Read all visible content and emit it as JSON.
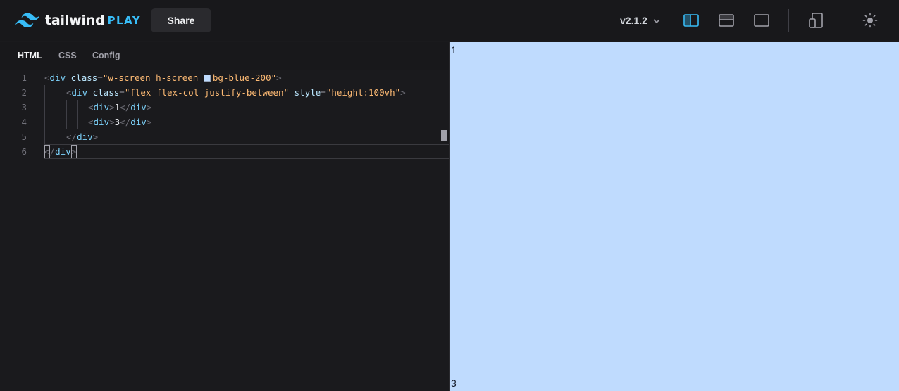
{
  "header": {
    "logo_word": "tailwind",
    "logo_play": "PLAY",
    "share_label": "Share",
    "version": "v2.1.2",
    "icons": [
      "logo-wave-icon",
      "layout-vertical-split-icon",
      "layout-horizontal-split-icon",
      "layout-preview-only-icon",
      "responsive-design-icon",
      "theme-sun-icon",
      "chevron-down-icon"
    ],
    "accent_color": "#38bdf8"
  },
  "tabs": [
    {
      "label": "HTML",
      "active": true
    },
    {
      "label": "CSS",
      "active": false
    },
    {
      "label": "Config",
      "active": false
    }
  ],
  "editor": {
    "line_numbers": [
      "1",
      "2",
      "3",
      "4",
      "5",
      "6"
    ],
    "lines": [
      [
        "<",
        "div",
        " ",
        "class",
        "=",
        "\"w-screen h-screen ",
        "bg-blue-200\"",
        ">"
      ],
      [
        "<",
        "div",
        " ",
        "class",
        "=",
        "\"flex flex-col justify-between\"",
        " ",
        "style",
        "=",
        "\"height:100vh\"",
        ">"
      ],
      [
        "<",
        "div",
        ">",
        "1",
        "</",
        "div",
        ">"
      ],
      [
        "<",
        "div",
        ">",
        "3",
        "</",
        "div",
        ">"
      ],
      [
        "</",
        "div",
        ">"
      ],
      [
        "</",
        "div",
        ">"
      ]
    ],
    "swatch_color": "#bfdbfe"
  },
  "preview": {
    "top_text": "1",
    "bottom_text": "3",
    "background": "#bfdbfe"
  }
}
